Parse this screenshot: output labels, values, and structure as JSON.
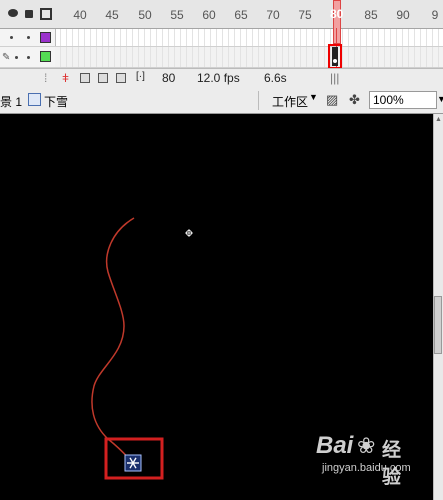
{
  "timeline": {
    "frame_numbers": [
      "40",
      "45",
      "50",
      "55",
      "60",
      "65",
      "70",
      "75",
      "80",
      "85",
      "90"
    ],
    "current_frame_marker": "80",
    "layers": [
      {
        "color": "#9b33cc"
      },
      {
        "color": "#55dd55"
      }
    ]
  },
  "status": {
    "frame": "80",
    "fps": "12.0 fps",
    "time": "6.6s"
  },
  "editbar": {
    "scene": "景 1",
    "symbol": "下雪",
    "workspace": "工作区",
    "zoom": "100%"
  },
  "watermark": {
    "brand": "Bai",
    "brand_cn": "经验",
    "url": "jingyan.baidu.com"
  }
}
